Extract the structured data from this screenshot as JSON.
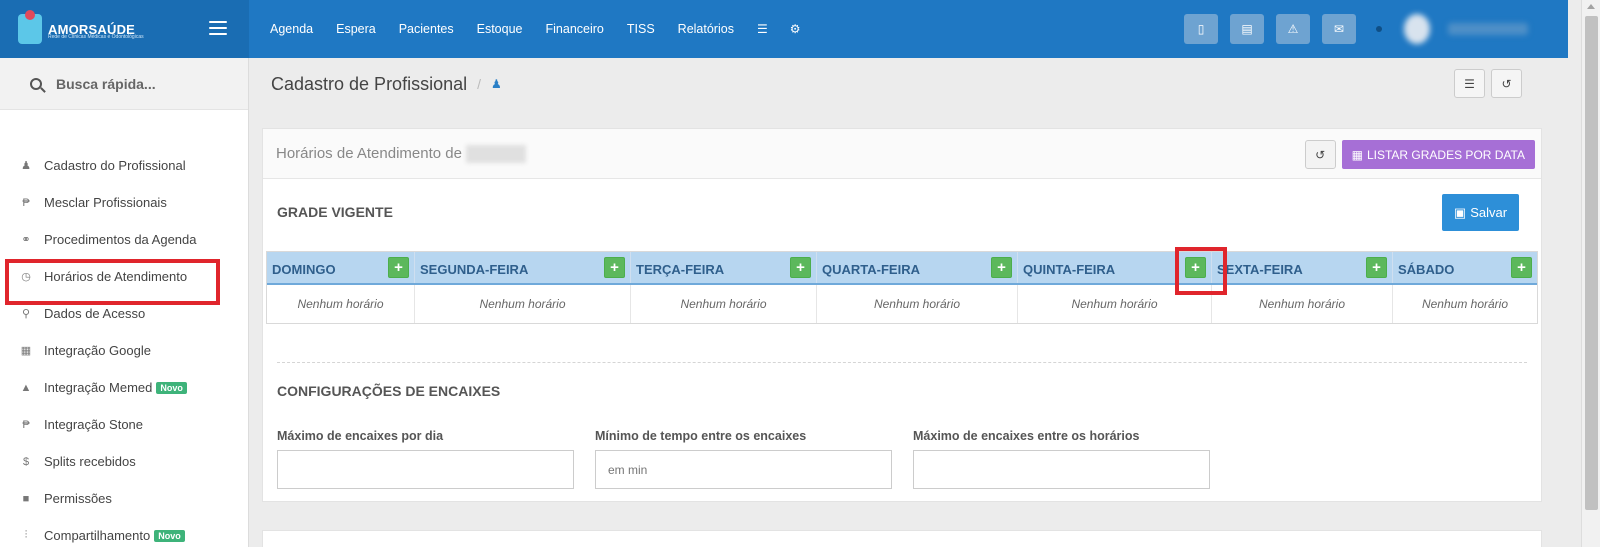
{
  "brand": {
    "name": "AMORSAÚDE",
    "subtitle": "Rede de Clínicas Médicas e Odontológicas"
  },
  "nav": {
    "items": [
      "Agenda",
      "Espera",
      "Pacientes",
      "Estoque",
      "Financeiro",
      "TISS",
      "Relatórios"
    ]
  },
  "sidebar": {
    "search_label": "Busca rápida...",
    "items": [
      {
        "label": "Cadastro do Profissional",
        "icon": "user-doctor-icon"
      },
      {
        "label": "Mesclar Profissionais",
        "icon": "merge-icon"
      },
      {
        "label": "Procedimentos da Agenda",
        "icon": "stethoscope-icon"
      },
      {
        "label": "Horários de Atendimento",
        "icon": "clock-icon"
      },
      {
        "label": "Dados de Acesso",
        "icon": "key-icon"
      },
      {
        "label": "Integração Google",
        "icon": "calendar-icon"
      },
      {
        "label": "Integração Memed",
        "icon": "flask-icon",
        "badge": "Novo"
      },
      {
        "label": "Integração Stone",
        "icon": "stone-icon"
      },
      {
        "label": "Splits recebidos",
        "icon": "dollar-icon"
      },
      {
        "label": "Permissões",
        "icon": "lock-icon"
      },
      {
        "label": "Compartilhamento",
        "icon": "share-icon",
        "badge": "Novo"
      }
    ]
  },
  "page": {
    "title": "Cadastro de Profissional",
    "breadcrumb_sep": "/"
  },
  "panel": {
    "title": "Horários de Atendimento de",
    "list_button": "LISTAR GRADES POR DATA",
    "save_button": "Salvar",
    "grade_title": "GRADE VIGENTE",
    "days": [
      "DOMINGO",
      "SEGUNDA-FEIRA",
      "TERÇA-FEIRA",
      "QUARTA-FEIRA",
      "QUINTA-FEIRA",
      "SEXTA-FEIRA",
      "SÁBADO"
    ],
    "empty_text": "Nenhum horário",
    "encaixes_title": "CONFIGURAÇÕES DE ENCAIXES",
    "fields": [
      {
        "label": "Máximo de encaixes por dia",
        "value": "",
        "placeholder": ""
      },
      {
        "label": "Mínimo de tempo entre os encaixes",
        "value": "",
        "placeholder": "em min"
      },
      {
        "label": "Máximo de encaixes entre os horários",
        "value": "",
        "placeholder": ""
      }
    ]
  },
  "colors": {
    "topbar": "#1f78c3",
    "grid_header": "#b7d6f0",
    "add_button": "#5cb85c",
    "purple": "#a66fd6",
    "save": "#2d8fd8",
    "highlight": "#e0252c"
  }
}
